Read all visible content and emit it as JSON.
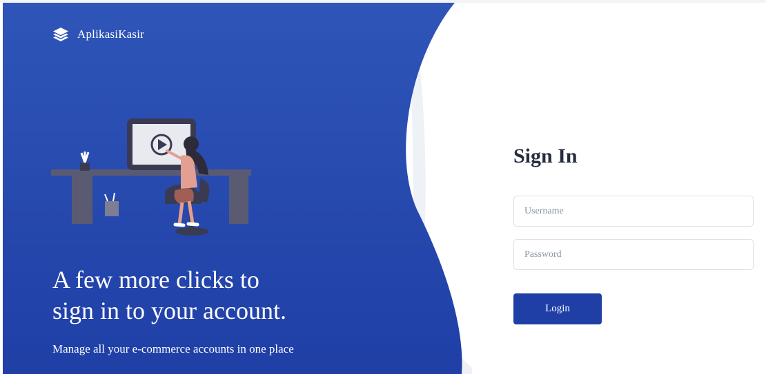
{
  "brand": {
    "name": "AplikasiKasir",
    "icon": "layers-icon"
  },
  "hero": {
    "headline_line1": "A few more clicks to",
    "headline_line2": "sign in to your account.",
    "subtitle": "Manage all your e-commerce accounts in one place"
  },
  "form": {
    "title": "Sign In",
    "username": {
      "placeholder": "Username",
      "value": ""
    },
    "password": {
      "placeholder": "Password",
      "value": ""
    },
    "login_label": "Login"
  },
  "colors": {
    "panel_top": "#2f55b8",
    "panel_bottom": "#1f3fa6",
    "button": "#1f3fa6",
    "title": "#252d3d"
  }
}
